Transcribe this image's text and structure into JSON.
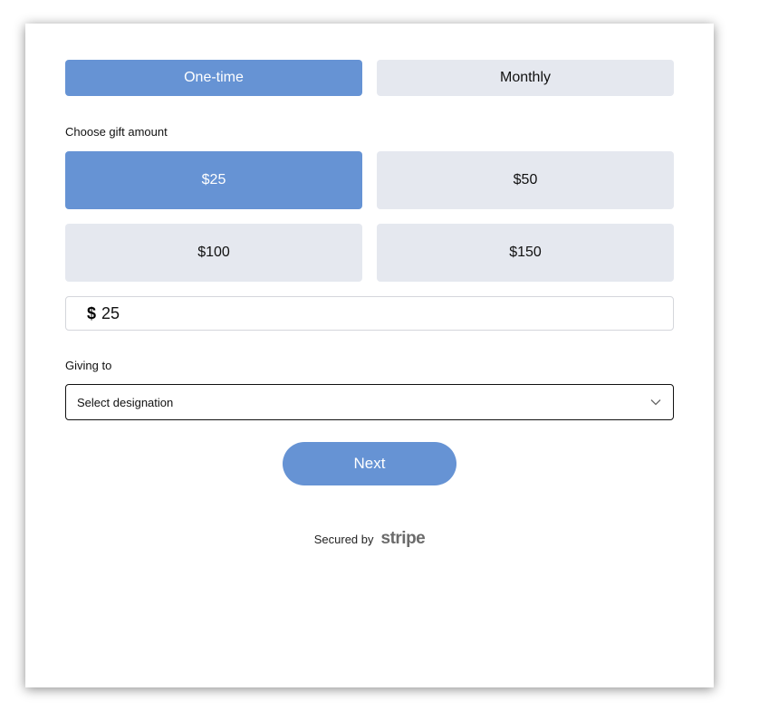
{
  "frequency": {
    "options": [
      "One-time",
      "Monthly"
    ],
    "selected": "One-time"
  },
  "amount": {
    "label": "Choose gift amount",
    "options": [
      "$25",
      "$50",
      "$100",
      "$150"
    ],
    "selected": "$25",
    "currency_symbol": "$",
    "custom_value": "25"
  },
  "designation": {
    "label": "Giving to",
    "placeholder": "Select designation"
  },
  "next_label": "Next",
  "footer": {
    "secured_text": "Secured by",
    "brand": "stripe"
  },
  "colors": {
    "accent": "#6693d4",
    "inactive": "#e5e8ef"
  },
  "icons": {
    "select_chevron": "chevron-down-icon"
  }
}
